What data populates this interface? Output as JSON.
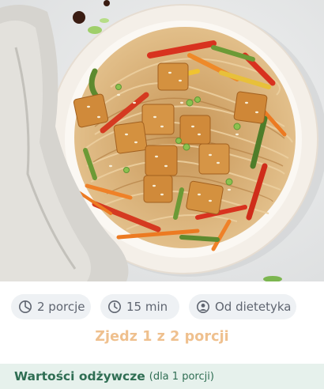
{
  "hero": {
    "image": "stir-fried noodles with tofu and vegetables"
  },
  "chips": {
    "portions": {
      "icon": "pie-chart-icon",
      "label": "2 porcje"
    },
    "time": {
      "icon": "clock-icon",
      "label": "15 min"
    },
    "source": {
      "icon": "user-circle-icon",
      "label": "Od dietetyka"
    }
  },
  "eat_portions": "Zjedz 1 z 2 porcji",
  "nutrition": {
    "title": "Wartości odżywcze",
    "subtitle": "(dla 1 porcji)"
  },
  "colors": {
    "accent": "#efc08e",
    "nutrition_text": "#2f6e53",
    "nutrition_bg": "#e6f1ec",
    "chip_bg": "#eef1f4"
  }
}
